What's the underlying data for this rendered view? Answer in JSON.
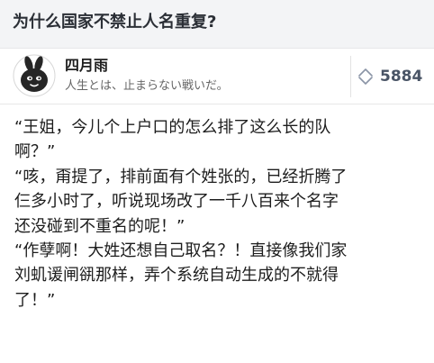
{
  "question": {
    "title": "为什么国家不禁止人名重复?"
  },
  "author": {
    "name": "四月雨",
    "bio": "人生とは、止まらない戦いだ。",
    "avatar_icon": "rabbit-avatar-icon"
  },
  "vote": {
    "count": "5884",
    "up_icon": "chevron-up-icon",
    "down_icon": "chevron-down-icon"
  },
  "answer": {
    "lines": [
      "“王姐，今儿个上户口的怎么排了这么长的队",
      "啊？”",
      "“咳，甭提了，排前面有个姓张的，已经折腾了",
      "仨多小时了，听说现场改了一千八百来个名字",
      "还没碰到不重名的呢！”",
      "“作孽啊！大姓还想自己取名？！直接像我们家",
      "刘虮谖闸谻那样，弄个系统自动生成的不就得",
      "了！”"
    ]
  }
}
